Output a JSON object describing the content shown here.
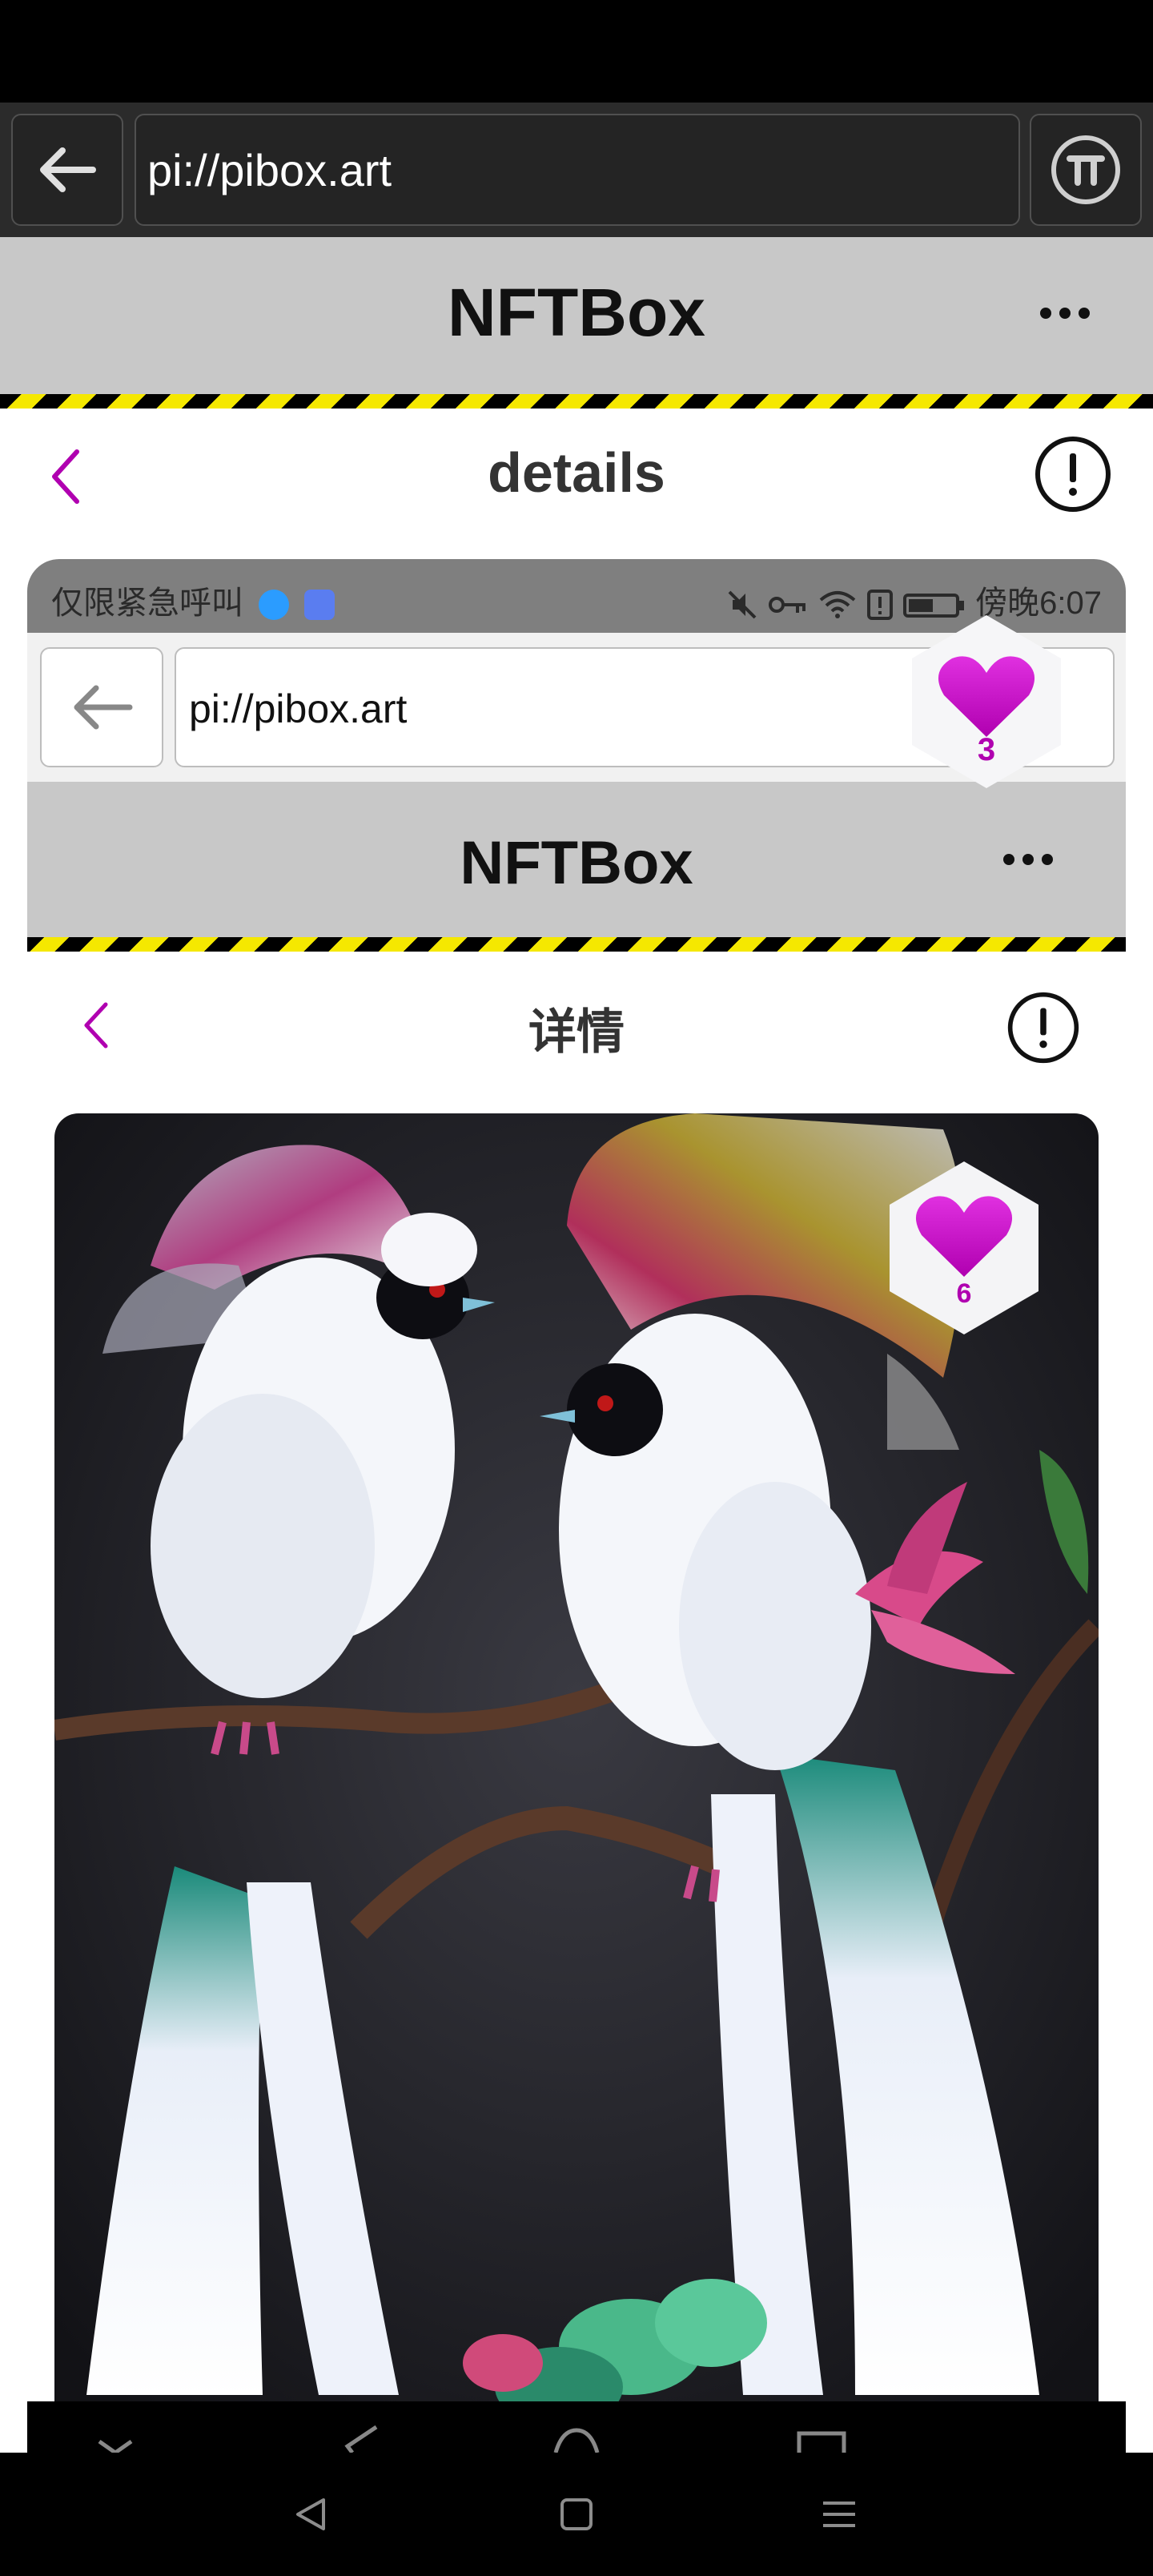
{
  "browser": {
    "url": "pi://pibox.art"
  },
  "app": {
    "title": "NFTBox"
  },
  "page": {
    "title": "details"
  },
  "like_badge": {
    "count": "3"
  },
  "inner": {
    "status": {
      "left_text": "仅限紧急呼叫",
      "time": "傍晚6:07"
    },
    "browser": {
      "url": "pi://pibox.art"
    },
    "app": {
      "title": "NFTBox"
    },
    "page": {
      "title": "详情"
    },
    "like_badge": {
      "count": "6"
    }
  },
  "colors": {
    "accent": "#b000b0",
    "hazard_yellow": "#f5e800",
    "header_gray": "#c8c8c8"
  },
  "icons": [
    "back-arrow-icon",
    "pi-logo-icon",
    "more-dots-icon",
    "chevron-left-icon",
    "info-icon",
    "heart-icon"
  ]
}
